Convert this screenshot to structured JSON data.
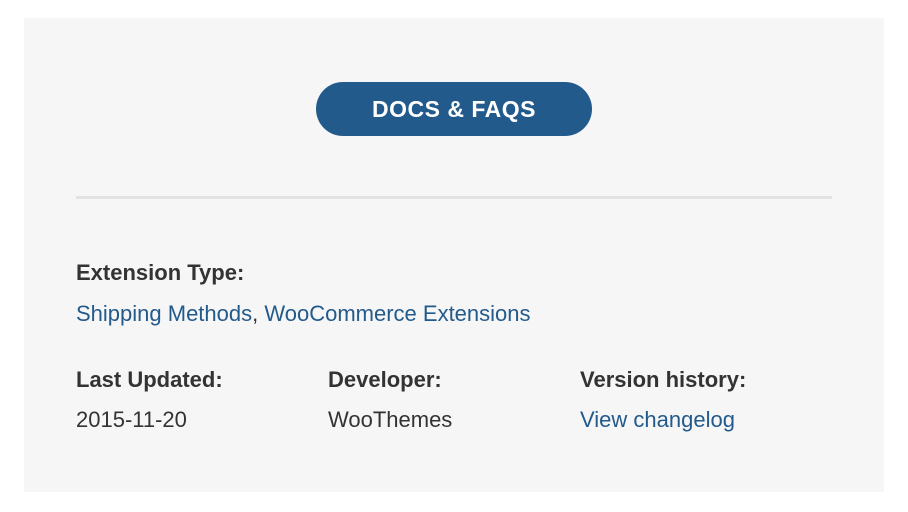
{
  "docs_button": {
    "label": "DOCS & FAQS"
  },
  "extension_type": {
    "label": "Extension Type:",
    "links": [
      "Shipping Methods",
      "WooCommerce Extensions"
    ],
    "separator": ","
  },
  "meta": {
    "last_updated": {
      "label": "Last Updated:",
      "value": "2015-11-20"
    },
    "developer": {
      "label": "Developer:",
      "value": "WooThemes"
    },
    "version_history": {
      "label": "Version history:",
      "link": "View changelog"
    }
  },
  "colors": {
    "panel_background": "#f6f6f6",
    "accent": "#235a8c",
    "text": "#333333",
    "divider": "#e3e3e3"
  }
}
